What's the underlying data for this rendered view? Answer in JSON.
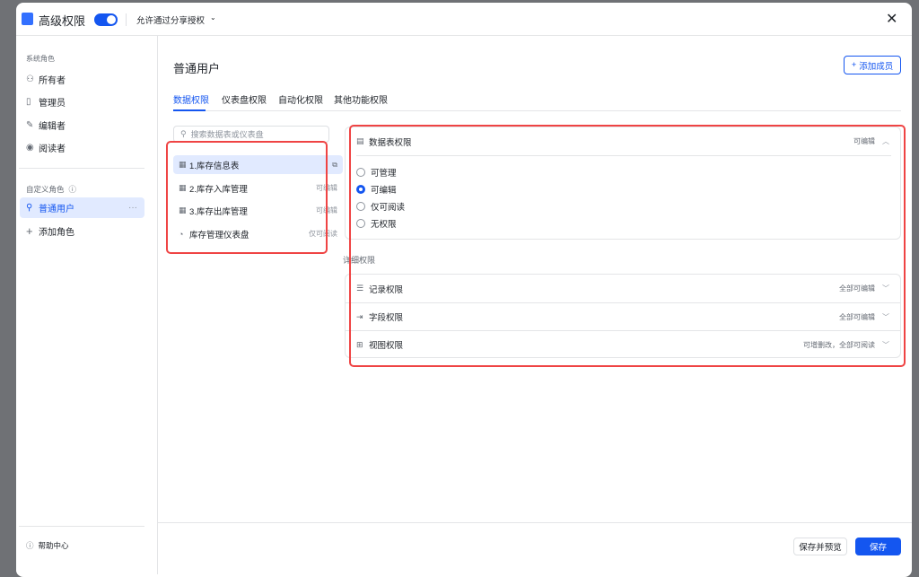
{
  "header": {
    "title": "高级权限",
    "toggle_on": true,
    "share_label": "允许通过分享授权"
  },
  "sidebar": {
    "system_section": "系统角色",
    "system_roles": [
      {
        "label": "所有者",
        "icon": "users-icon"
      },
      {
        "label": "管理员",
        "icon": "admin-icon"
      },
      {
        "label": "编辑者",
        "icon": "pencil-icon"
      },
      {
        "label": "阅读者",
        "icon": "eye-icon"
      }
    ],
    "custom_section": "自定义角色",
    "custom_roles": [
      {
        "label": "普通用户",
        "more": "···"
      }
    ],
    "add_role": "添加角色",
    "help": "帮助中心"
  },
  "main": {
    "title": "普通用户",
    "add_member": "添加成员",
    "tabs": [
      "数据权限",
      "仪表盘权限",
      "自动化权限",
      "其他功能权限"
    ],
    "search_placeholder": "搜索数据表或仪表盘",
    "items": [
      {
        "label": "1.库存信息表",
        "status": ""
      },
      {
        "label": "2.库存入库管理",
        "status": "可编辑"
      },
      {
        "label": "3.库存出库管理",
        "status": "可编辑"
      },
      {
        "label": "库存管理仪表盘",
        "status": "仅可阅读"
      }
    ],
    "table_perm": {
      "title": "数据表权限",
      "status": "可编辑",
      "options": [
        "可管理",
        "可编辑",
        "仅可阅读",
        "无权限"
      ],
      "selected": 1
    },
    "detail_title": "详细权限",
    "details": [
      {
        "label": "记录权限",
        "status": "全部可编辑"
      },
      {
        "label": "字段权限",
        "status": "全部可编辑"
      },
      {
        "label": "视图权限",
        "status": "可增删改，全部可阅读"
      }
    ]
  },
  "footer": {
    "save_preview": "保存并预览",
    "save": "保存"
  },
  "colors": {
    "accent": "#1456f0",
    "highlight": "#ef4444"
  }
}
